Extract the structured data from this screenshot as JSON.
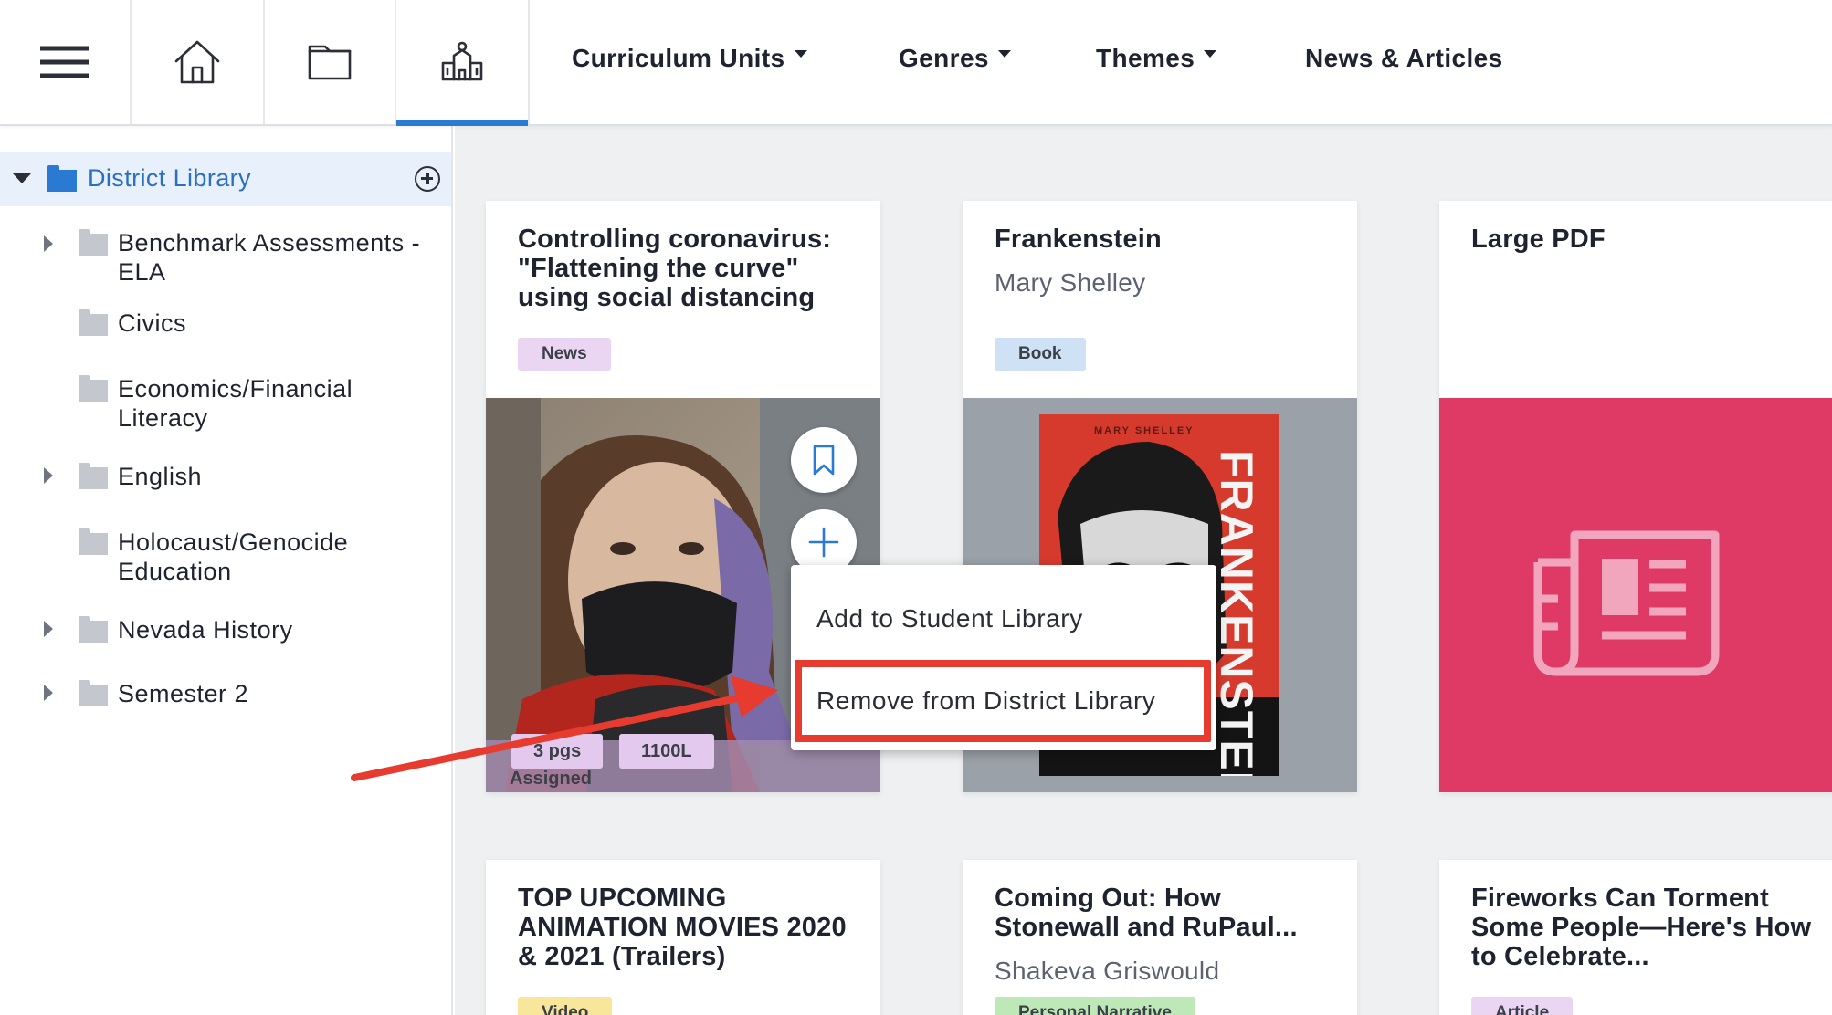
{
  "nav": {
    "icons": [
      "hamburger-menu-icon",
      "home-icon",
      "book-icon",
      "school-icon"
    ],
    "items": [
      {
        "label": "Curriculum Units",
        "dropdown": true
      },
      {
        "label": "Genres",
        "dropdown": true
      },
      {
        "label": "Themes",
        "dropdown": true
      },
      {
        "label": "News & Articles",
        "dropdown": false
      }
    ],
    "active_index": 3
  },
  "sidebar": {
    "root": {
      "label": "District Library",
      "expanded": true
    },
    "items": [
      {
        "label": "Benchmark Assessments - ELA",
        "expandable": true
      },
      {
        "label": "Civics",
        "expandable": false
      },
      {
        "label": "Economics/Financial Literacy",
        "expandable": false
      },
      {
        "label": "English",
        "expandable": true
      },
      {
        "label": "Holocaust/Genocide Education",
        "expandable": false
      },
      {
        "label": "Nevada History",
        "expandable": true
      },
      {
        "label": "Semester 2",
        "expandable": true
      }
    ]
  },
  "cards": [
    {
      "title": "Controlling coronavirus: \"Flattening the curve\" using social distancing",
      "tag": "News",
      "chips": [
        "3 pgs",
        "1100L"
      ],
      "status": "Assigned"
    },
    {
      "title": "Frankenstein",
      "author": "Mary Shelley",
      "tag": "Book",
      "cover_author": "MARY SHELLEY",
      "cover_title": "FRANKENSTEIN"
    },
    {
      "title": "Large PDF"
    },
    {
      "title": "TOP UPCOMING ANIMATION MOVIES 2020 & 2021 (Trailers)",
      "tag": "Video"
    },
    {
      "title": "Coming Out: How Stonewall and RuPaul...",
      "author": "Shakeva Griswould",
      "tag": "Personal Narrative"
    },
    {
      "title": "Fireworks Can Torment Some People—Here's How to Celebrate...",
      "tag": "Article"
    }
  ],
  "menu": {
    "items": [
      "Add to Student Library",
      "Remove from District Library"
    ],
    "highlighted_index": 1
  },
  "colors": {
    "accent": "#2a79d3",
    "annotation": "#e63b2e",
    "news_tag": "#ead6f3",
    "book_tag": "#cfe1f5",
    "video_tag": "#f8e79a",
    "narrative_tag": "#bfe8b8",
    "pdf_bg": "#df3a66"
  }
}
